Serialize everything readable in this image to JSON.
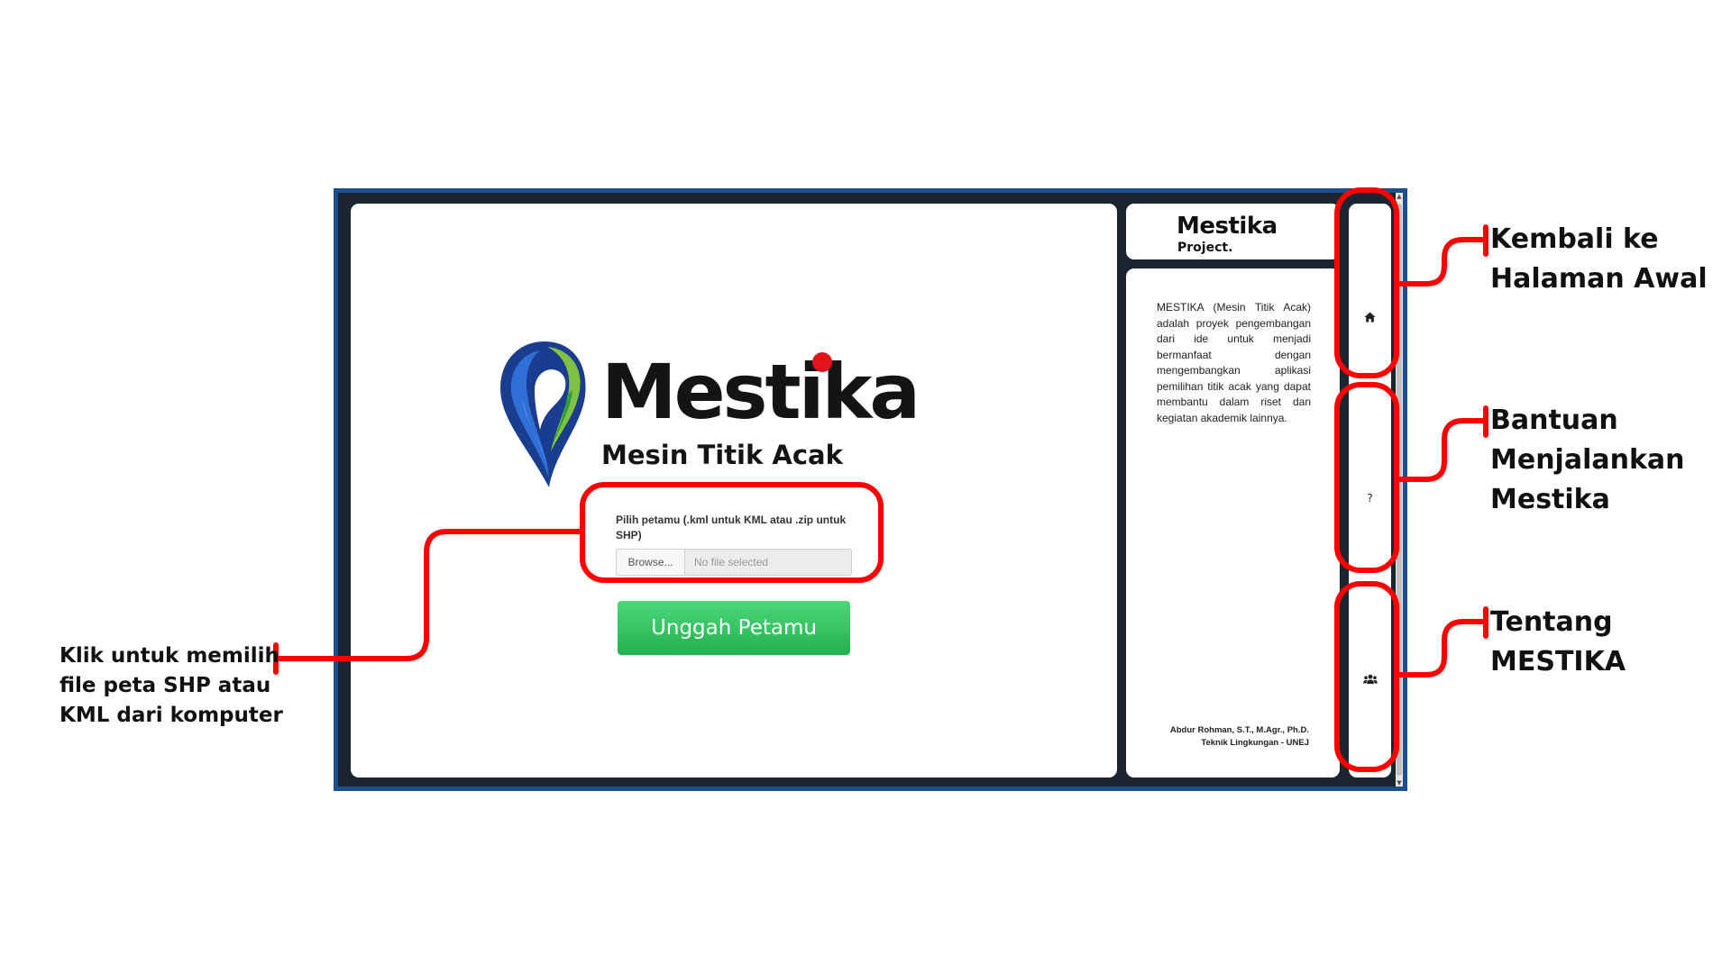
{
  "app": {
    "logo_word": "Mestika",
    "tagline": "Mesin Titik Acak",
    "upload_label": "Pilih petamu (.kml untuk KML atau .zip untuk SHP)",
    "browse_label": "Browse...",
    "file_status": "No file selected",
    "upload_button": "Unggah Petamu"
  },
  "sidebar": {
    "brand_title": "Mestika",
    "brand_sub": "Project.",
    "description": "MESTIKA (Mesin Titik Acak) adalah proyek pengembangan dari ide untuk menjadi bermanfaat dengan mengembangkan aplikasi pemilihan titik acak yang dapat membantu dalam riset dan kegiatan akademik lainnya.",
    "credit_name": "Abdur Rohman, S.T., M.Agr., Ph.D.",
    "credit_affiliation": "Teknik Lingkungan - UNEJ"
  },
  "nav": {
    "home_icon": "house-icon",
    "help_label": "?",
    "about_icon": "users-icon"
  },
  "annotations": {
    "home_1": "Kembali ke",
    "home_2": "Halaman Awal",
    "help_1": "Bantuan",
    "help_2": "Menjalankan",
    "help_3": "Mestika",
    "about_1": "Tentang",
    "about_2": "MESTIKA",
    "file_1": "Klik untuk memilih",
    "file_2": "file peta SHP atau",
    "file_3": "KML dari komputer"
  },
  "colors": {
    "accent_red": "#ff0000",
    "frame_blue": "#1d4f8f",
    "button_green": "#2fbf5a",
    "logo_dot_red": "#e3131b"
  }
}
